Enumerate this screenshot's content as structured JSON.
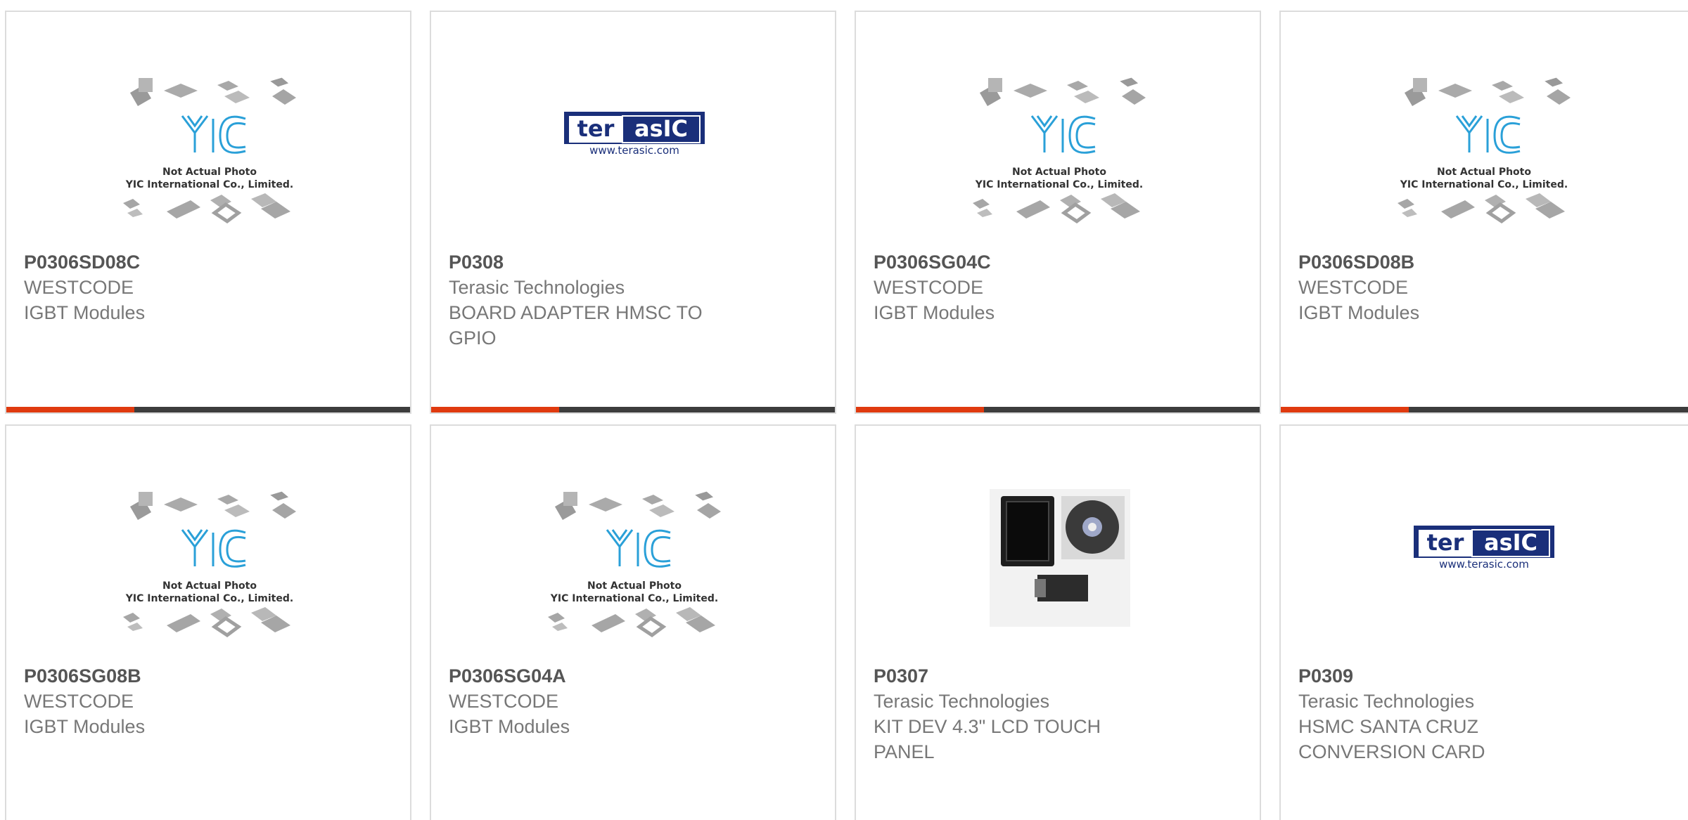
{
  "colors": {
    "accent": "#e03a0f",
    "bar": "#3d3d3d",
    "border": "#dcdcdc",
    "terasic_blue": "#1a2f7a"
  },
  "placeholder": {
    "caption_line1": "Not Actual Photo",
    "caption_line2": "YIC International Co., Limited.",
    "logo_text": "YIC"
  },
  "terasic_logo": {
    "left": "ter",
    "right": "asIC",
    "url": "www.terasic.com"
  },
  "products": [
    {
      "part": "P0306SD08C",
      "maker": "WESTCODE",
      "desc": "IGBT Modules",
      "image": "yic-placeholder"
    },
    {
      "part": "P0308",
      "maker": "Terasic Technologies",
      "desc": "BOARD ADAPTER HMSC TO GPIO",
      "image": "terasic-logo"
    },
    {
      "part": "P0306SG04C",
      "maker": "WESTCODE",
      "desc": "IGBT Modules",
      "image": "yic-placeholder"
    },
    {
      "part": "P0306SD08B",
      "maker": "WESTCODE",
      "desc": "IGBT Modules",
      "image": "yic-placeholder"
    },
    {
      "part": "P0306SG08B",
      "maker": "WESTCODE",
      "desc": "IGBT Modules",
      "image": "yic-placeholder"
    },
    {
      "part": "P0306SG04A",
      "maker": "WESTCODE",
      "desc": "IGBT Modules",
      "image": "yic-placeholder"
    },
    {
      "part": "P0307",
      "maker": "Terasic Technologies",
      "desc": "KIT DEV 4.3\" LCD TOUCH PANEL",
      "image": "lcd-kit-photo"
    },
    {
      "part": "P0309",
      "maker": "Terasic Technologies",
      "desc": "HSMC SANTA CRUZ CONVERSION CARD",
      "image": "terasic-logo"
    }
  ]
}
